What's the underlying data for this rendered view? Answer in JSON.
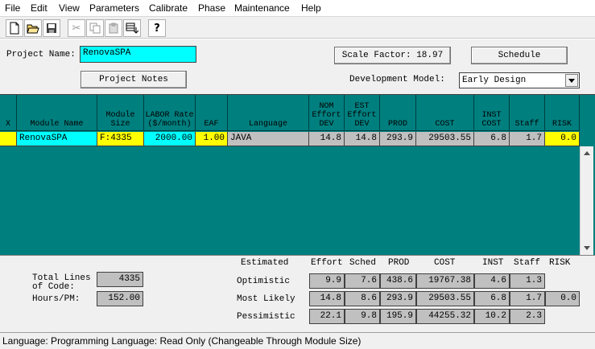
{
  "menu": [
    "File",
    "Edit",
    "View",
    "Parameters",
    "Calibrate",
    "Phase",
    "Maintenance",
    "Help"
  ],
  "form": {
    "project_name_label": "Project Name:",
    "project_name_value": "RenovaSPA",
    "scale_factor": "Scale Factor: 18.97",
    "schedule_button": "Schedule",
    "project_notes_button": "Project Notes",
    "dev_model_label": "Development Model:",
    "dev_model_value": "Early Design"
  },
  "grid": {
    "headers": {
      "x": "X",
      "module_name": "Module Name",
      "module_size": "Module Size",
      "labor_rate": "LABOR Rate ($/month)",
      "eaf": "EAF",
      "language": "Language",
      "nom_effort": "NOM Effort DEV",
      "est_effort": "EST Effort DEV",
      "prod": "PROD",
      "cost": "COST",
      "inst_cost": "INST COST",
      "staff": "Staff",
      "risk": "RISK"
    },
    "row": {
      "x": "",
      "module_name": "RenovaSPA",
      "module_size": "F:4335",
      "labor_rate": "2000.00",
      "eaf": "1.00",
      "language": "JAVA",
      "nom_effort": "14.8",
      "est_effort": "14.8",
      "prod": "293.9",
      "cost": "29503.55",
      "inst_cost": "6.8",
      "staff": "1.7",
      "risk": "0.0"
    }
  },
  "summary": {
    "total_lines_label": "Total Lines of Code:",
    "total_lines_value": "4335",
    "hours_pm_label": "Hours/PM:",
    "hours_pm_value": "152.00",
    "headers": {
      "estimated": "Estimated",
      "effort": "Effort",
      "sched": "Sched",
      "prod": "PROD",
      "cost": "COST",
      "inst": "INST",
      "staff": "Staff",
      "risk": "RISK"
    },
    "rows": [
      {
        "label": "Optimistic",
        "effort": "9.9",
        "sched": "7.6",
        "prod": "438.6",
        "cost": "19767.38",
        "inst": "4.6",
        "staff": "1.3",
        "risk": ""
      },
      {
        "label": "Most Likely",
        "effort": "14.8",
        "sched": "8.6",
        "prod": "293.9",
        "cost": "29503.55",
        "inst": "6.8",
        "staff": "1.7",
        "risk": "0.0"
      },
      {
        "label": "Pessimistic",
        "effort": "22.1",
        "sched": "9.8",
        "prod": "195.9",
        "cost": "44255.32",
        "inst": "10.2",
        "staff": "2.3",
        "risk": ""
      }
    ]
  },
  "status": "Language: Programming Language: Read Only (Changeable Through Module Size)",
  "colors": {
    "grid_bg": "#007f7f",
    "cyan": "#00ffff",
    "yellow": "#ffff00",
    "gray": "#c0c0c0"
  }
}
